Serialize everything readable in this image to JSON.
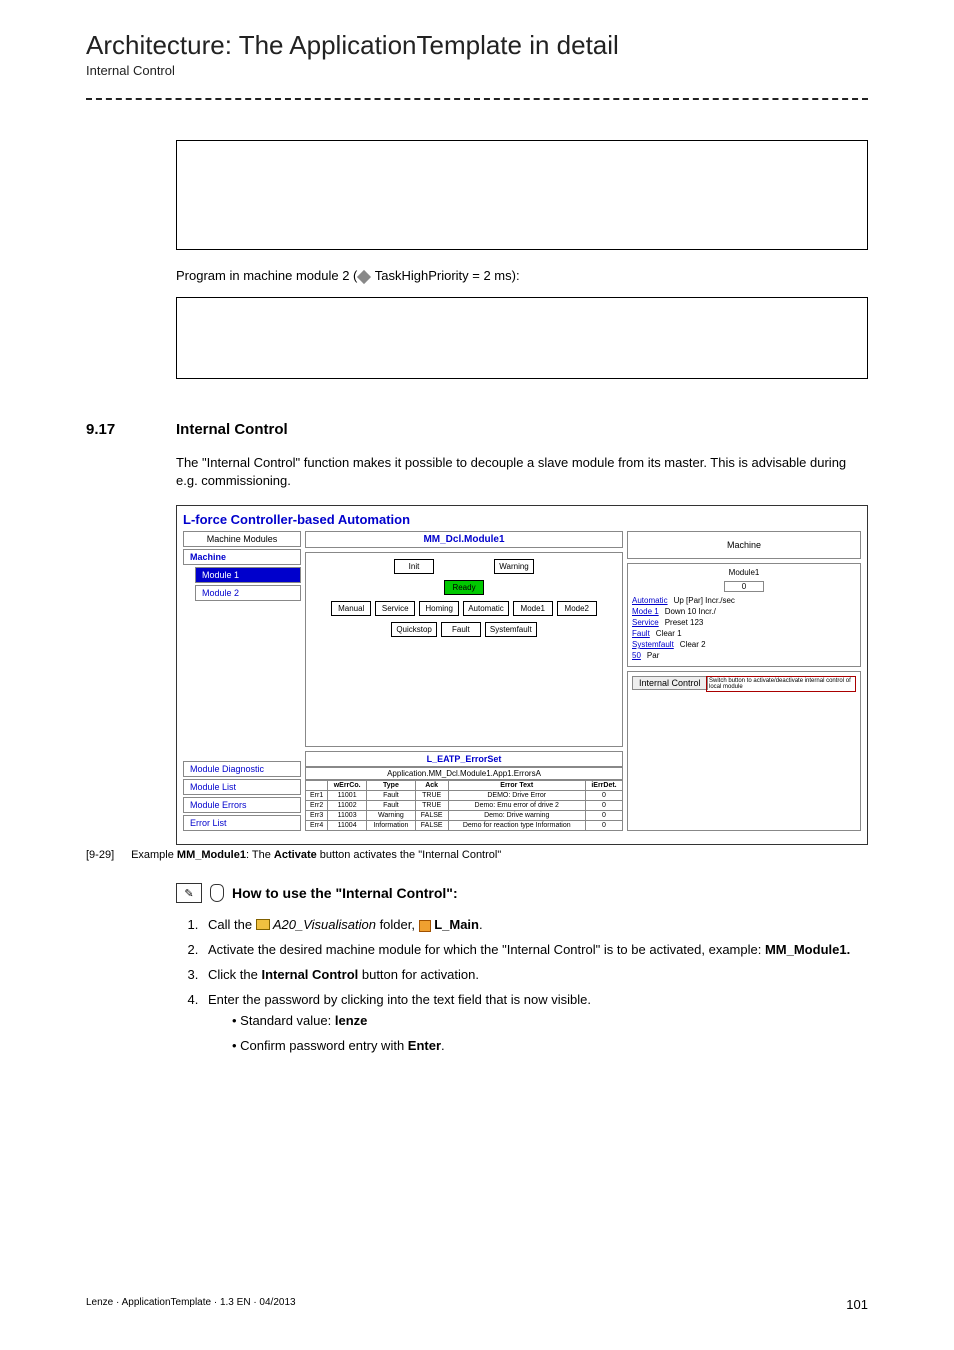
{
  "page": {
    "title": "Architecture: The ApplicationTemplate in detail",
    "subtitle": "Internal Control"
  },
  "program_line_prefix": "Program in machine module 2 (",
  "program_line_suffix": " TaskHighPriority = 2 ms):",
  "section": {
    "num": "9.17",
    "title": "Internal Control"
  },
  "intro_text": "The \"Internal Control\" function makes it possible to decouple a slave module from its master. This is advisable during e.g. commissioning.",
  "ui": {
    "app_title": "L-force Controller-based Automation",
    "left_header": "Machine Modules",
    "tree": {
      "machine": "Machine",
      "module1": "Module 1",
      "module2": "Module 2"
    },
    "left_buttons": {
      "module_diag": "Module Diagnostic",
      "module_list": "Module List",
      "module_errors": "Module Errors",
      "error_list": "Error List"
    },
    "center_header": "MM_Dcl.Module1",
    "states": {
      "init": "Init",
      "warning": "Warning",
      "ready": "Ready",
      "manual": "Manual",
      "service": "Service",
      "homing": "Homing",
      "automatic": "Automatic",
      "mode1": "Mode1",
      "mode2": "Mode2",
      "quickstop": "Quickstop",
      "fault": "Fault",
      "systemfault": "Systemfault"
    },
    "errorset": {
      "title": "L_EATP_ErrorSet",
      "subtitle": "Application.MM_Dcl.Module1.App1.ErrorsA",
      "cols": {
        "row": "",
        "werrco": "wErrCo.",
        "type": "Type",
        "ack": "Ack",
        "errtext": "Error Text",
        "errdet": "iErrDet."
      },
      "rows": [
        {
          "r": "Err1",
          "code": "11001",
          "type": "Fault",
          "ack": "TRUE",
          "text": "DEMO: Drive Error",
          "det": "0"
        },
        {
          "r": "Err2",
          "code": "11002",
          "type": "Fault",
          "ack": "TRUE",
          "text": "Demo: Emu error of drive 2",
          "det": "0"
        },
        {
          "r": "Err3",
          "code": "11003",
          "type": "Warning",
          "ack": "FALSE",
          "text": "Demo: Drive warning",
          "det": "0"
        },
        {
          "r": "Err4",
          "code": "11004",
          "type": "Information",
          "ack": "FALSE",
          "text": "Demo for reaction type Information",
          "det": "0"
        }
      ]
    },
    "right": {
      "machine": "Machine",
      "module1": "Module1",
      "module1_val": "0",
      "items": {
        "automatic": "Automatic",
        "mode1": "Mode 1",
        "service": "Service",
        "fault": "Fault",
        "systemfault": "Systemfault",
        "num50": "50",
        "up": "Up [Par] Incr./sec",
        "down": "Down 10 Incr./",
        "preset": "Preset 123",
        "clear1": "Clear 1",
        "clear2": "Clear 2",
        "par": "Par"
      },
      "internal_control_btn": "Internal Control",
      "switch_note": "Switch button to activate/deactivate internal control of local module"
    }
  },
  "caption": {
    "num": "[9-29]",
    "prefix": "Example ",
    "bold1": "MM_Module1",
    "mid": ": The ",
    "bold2": "Activate",
    "suffix": " button activates the \"Internal Control\""
  },
  "howto": {
    "title": "How to use the \"Internal Control\":"
  },
  "steps": {
    "s1_a": "Call the ",
    "s1_b": " A20_Visualisation",
    "s1_c": " folder, ",
    "s1_d": " L_Main",
    "s1_e": ".",
    "s2_a": "Activate the desired machine module for which the \"Internal Control\" is to be activated, example: ",
    "s2_b": "MM_Module1.",
    "s3_a": "Click the ",
    "s3_b": "Internal Control",
    "s3_c": " button for activation.",
    "s4_a": "Enter the password by clicking into the text field that is now visible.",
    "s4_sub1_a": "Standard value: ",
    "s4_sub1_b": "lenze",
    "s4_sub2_a": "Confirm password entry with ",
    "s4_sub2_b": "Enter",
    "s4_sub2_c": "."
  },
  "footer": {
    "left": "Lenze · ApplicationTemplate · 1.3 EN · 04/2013",
    "page": "101"
  }
}
